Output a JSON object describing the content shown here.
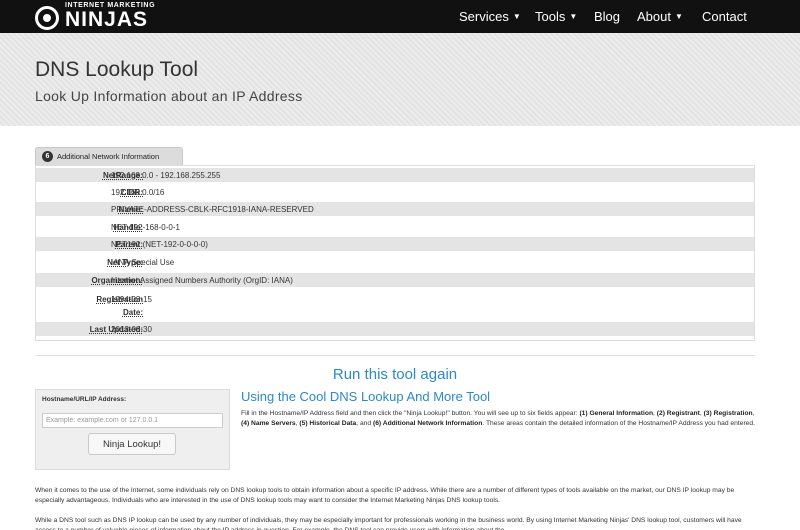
{
  "brand": {
    "small": "INTERNET MARKETING",
    "big": "NINJAS"
  },
  "nav": {
    "items": [
      {
        "label": "Services",
        "dropdown": true
      },
      {
        "label": "Tools",
        "dropdown": true
      },
      {
        "label": "Blog",
        "dropdown": false
      },
      {
        "label": "About",
        "dropdown": true
      },
      {
        "label": "Contact",
        "dropdown": false
      }
    ],
    "caret": "▼"
  },
  "hero": {
    "title": "DNS Lookup Tool",
    "subtitle": "Look Up Information about an IP Address"
  },
  "result": {
    "tab_number": "6",
    "tab_label": "Additional Network Information",
    "rows": [
      {
        "label": "NetRange:",
        "value": "192.168.0.0 - 192.168.255.255"
      },
      {
        "label": "CIDR:",
        "value": "192.168.0.0/16"
      },
      {
        "label": "Name:",
        "value": "PRIVATE-ADDRESS-CBLK-RFC1918-IANA-RESERVED"
      },
      {
        "label": "Handle:",
        "value": "NET-192-168-0-0-1"
      },
      {
        "label": "Parent:",
        "value": "NET192 (NET-192-0-0-0-0)"
      },
      {
        "label": "Net Type:",
        "value": "IANA Special Use"
      },
      {
        "label": "Organization:",
        "value": "Internet Assigned Numbers Authority (OrgID: IANA)"
      },
      {
        "label": "Registration Date:",
        "value": "1994-03-15"
      },
      {
        "label": "Last Updated:",
        "value": "2013-08-30"
      }
    ]
  },
  "run_again": {
    "heading": "Run this tool again",
    "field_label": "Hostname/URL/IP Address:",
    "placeholder": "Example: example.com or 127.0.0.1",
    "button": "Ninja Lookup!"
  },
  "tool_info": {
    "title": "Using the Cool DNS Lookup And More Tool",
    "desc_intro": "Fill in the Hostname/IP Address field and then click the \"Ninja Lookup!\" button. You will see up to six fields appear: ",
    "f1": "(1) General Information",
    "f2": "(2) Registrant",
    "f3": "(3) Registration",
    "f4": "(4) Name Servers",
    "f5": "(5) Historical Data",
    "f6": "(6) Additional Network Information",
    "desc_outro": ". These areas contain the detailed information of the Hostname/IP Address you had entered."
  },
  "paragraphs": [
    "When it comes to the use of the Internet, some individuals rely on DNS lookup tools to obtain information about a specific IP address. While there are a number of different types of tools available on the market, our DNS IP lookup may be especially advantageous. Individuals who are interested in the use of DNS lookup tools may want to consider the Internet Marketing Ninjas DNS lookup tools.",
    "While a DNS tool such as DNS IP lookup can be used by any number of individuals, they may be especially important for professionals working in the business world. By using Internet Marketing Ninjas' DNS lookup tool, customers will have access to a number of valuable pieces of information about the IP address in question. For example, the DNS tool can provide users with information about the"
  ]
}
